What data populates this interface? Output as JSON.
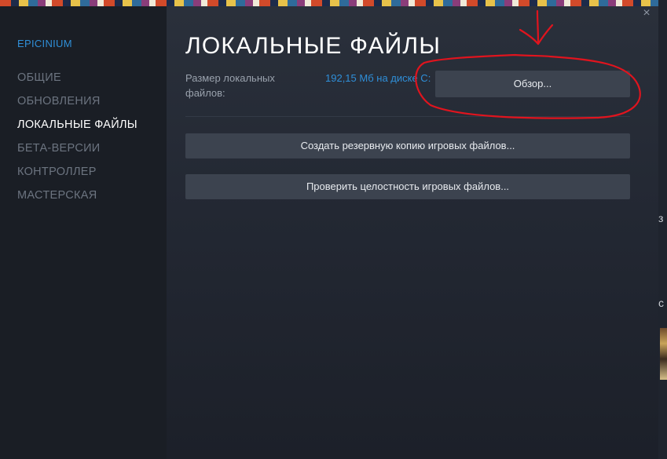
{
  "sidebar": {
    "game_title": "EPICINIUM",
    "items": [
      {
        "label": "ОБЩИЕ",
        "active": false
      },
      {
        "label": "ОБНОВЛЕНИЯ",
        "active": false
      },
      {
        "label": "ЛОКАЛЬНЫЕ ФАЙЛЫ",
        "active": true
      },
      {
        "label": "БЕТА-ВЕРСИИ",
        "active": false
      },
      {
        "label": "КОНТРОЛЛЕР",
        "active": false
      },
      {
        "label": "МАСТЕРСКАЯ",
        "active": false
      }
    ]
  },
  "main": {
    "title": "ЛОКАЛЬНЫЕ ФАЙЛЫ",
    "size_label": "Размер локальных файлов:",
    "size_value": "192,15 Мб на диске C:",
    "browse_label": "Обзор...",
    "backup_label": "Создать резервную копию игровых файлов...",
    "verify_label": "Проверить целостность игровых файлов..."
  },
  "window": {
    "close_glyph": "×"
  },
  "background": {
    "fragment_1": "з",
    "fragment_2": "с"
  },
  "icons": {
    "close": "close-icon"
  },
  "colors": {
    "accent_blue": "#2f8fd8",
    "button_bg": "#3c434f",
    "annotation_red": "#e0141e"
  }
}
